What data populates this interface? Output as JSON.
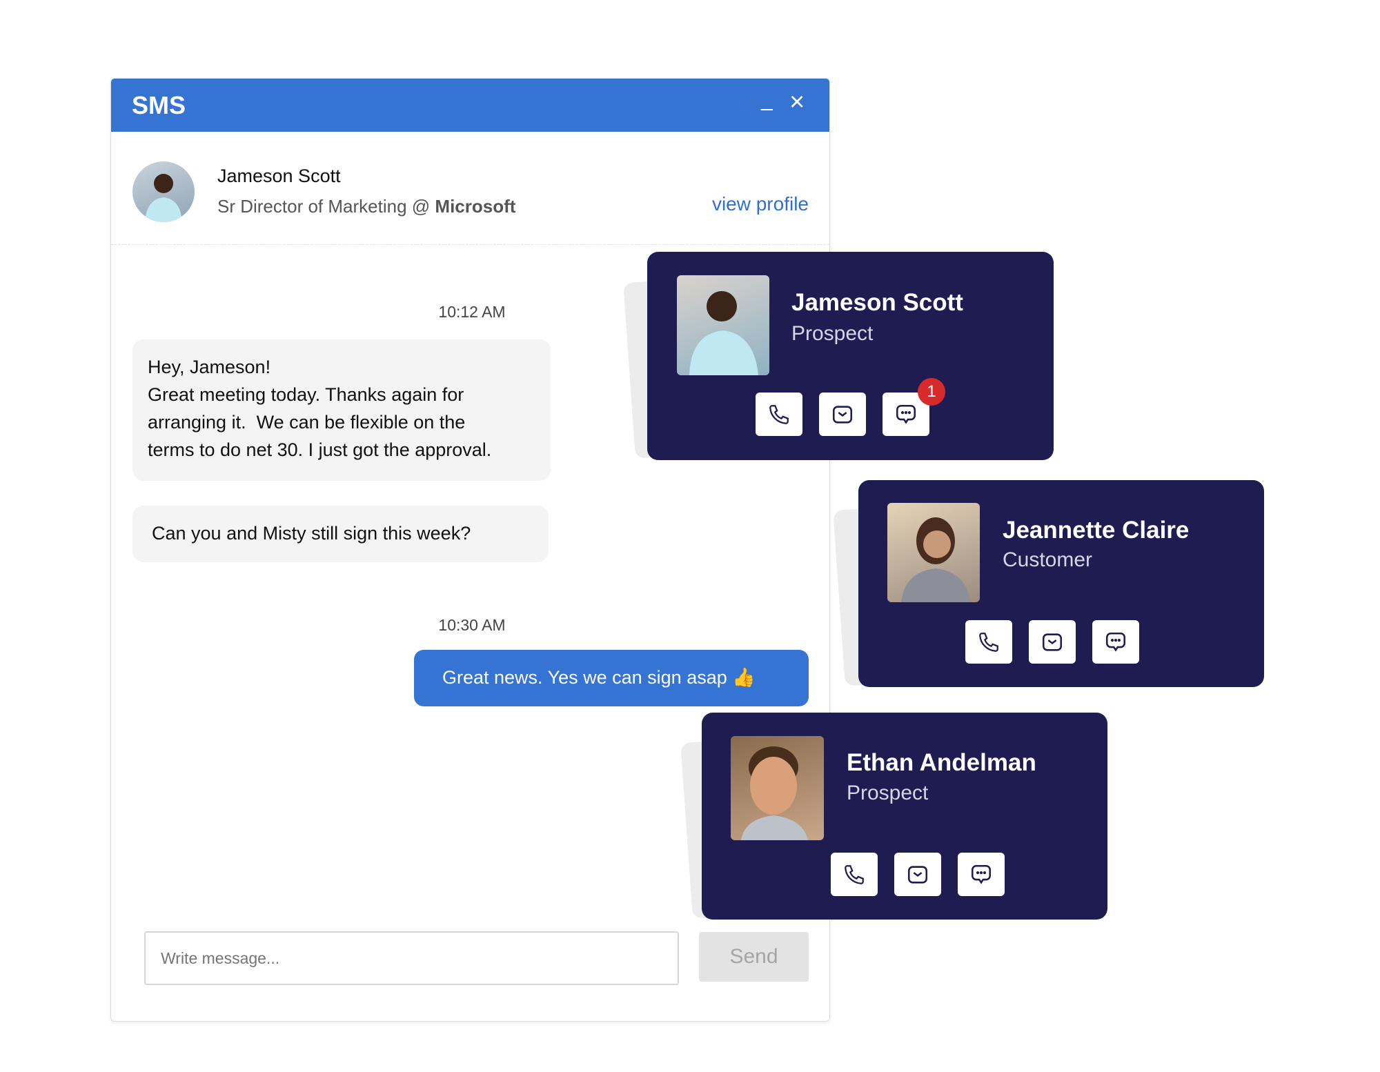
{
  "window": {
    "title": "SMS",
    "minimize_label": "_",
    "close_label": "×"
  },
  "contact": {
    "name": "Jameson Scott",
    "title": "Sr Director of Marketing",
    "at": "@",
    "company": "Microsoft",
    "view_profile": "view profile"
  },
  "messages": [
    {
      "time": "10:12 AM"
    },
    {
      "lines": [
        "Hey, Jameson!",
        "Great meeting today. Thanks again for",
        "arranging it.  We can be flexible on the",
        "terms to do net 30. I just got the approval."
      ]
    },
    {
      "text": "Can you and Misty still sign this week?"
    },
    {
      "time": "10:30 AM"
    },
    {
      "text": "Great news. Yes we can sign asap 👍"
    }
  ],
  "composer": {
    "placeholder": "Write message...",
    "send_label": "Send"
  },
  "cards": [
    {
      "name": "Jameson Scott",
      "role": "Prospect",
      "badge": "1"
    },
    {
      "name": "Jeannette Claire",
      "role": "Customer"
    },
    {
      "name": "Ethan Andelman",
      "role": "Prospect"
    }
  ],
  "colors": {
    "header": "#3574d2",
    "card": "#1f1c52",
    "badge": "#d72b2b",
    "link": "#2f6fd0"
  }
}
